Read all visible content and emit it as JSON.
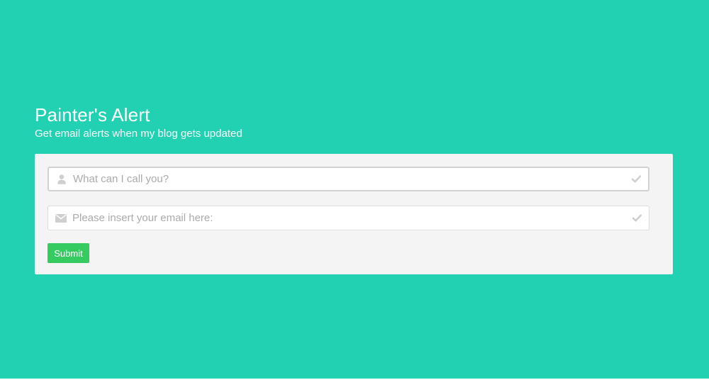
{
  "header": {
    "title": "Painter's Alert",
    "subtitle": "Get email alerts when my blog gets updated"
  },
  "form": {
    "name_field": {
      "placeholder": "What can I call you?",
      "value": "",
      "lead_icon": "user-icon",
      "trail_icon": "check-icon"
    },
    "email_field": {
      "placeholder": "Please insert your email here:",
      "value": "",
      "lead_icon": "envelope-icon",
      "trail_icon": "check-icon"
    },
    "submit_label": "Submit"
  },
  "colors": {
    "background": "#22d1b1",
    "card": "#f4f4f4",
    "button": "#36cb61",
    "icon": "#cfcfcf"
  }
}
